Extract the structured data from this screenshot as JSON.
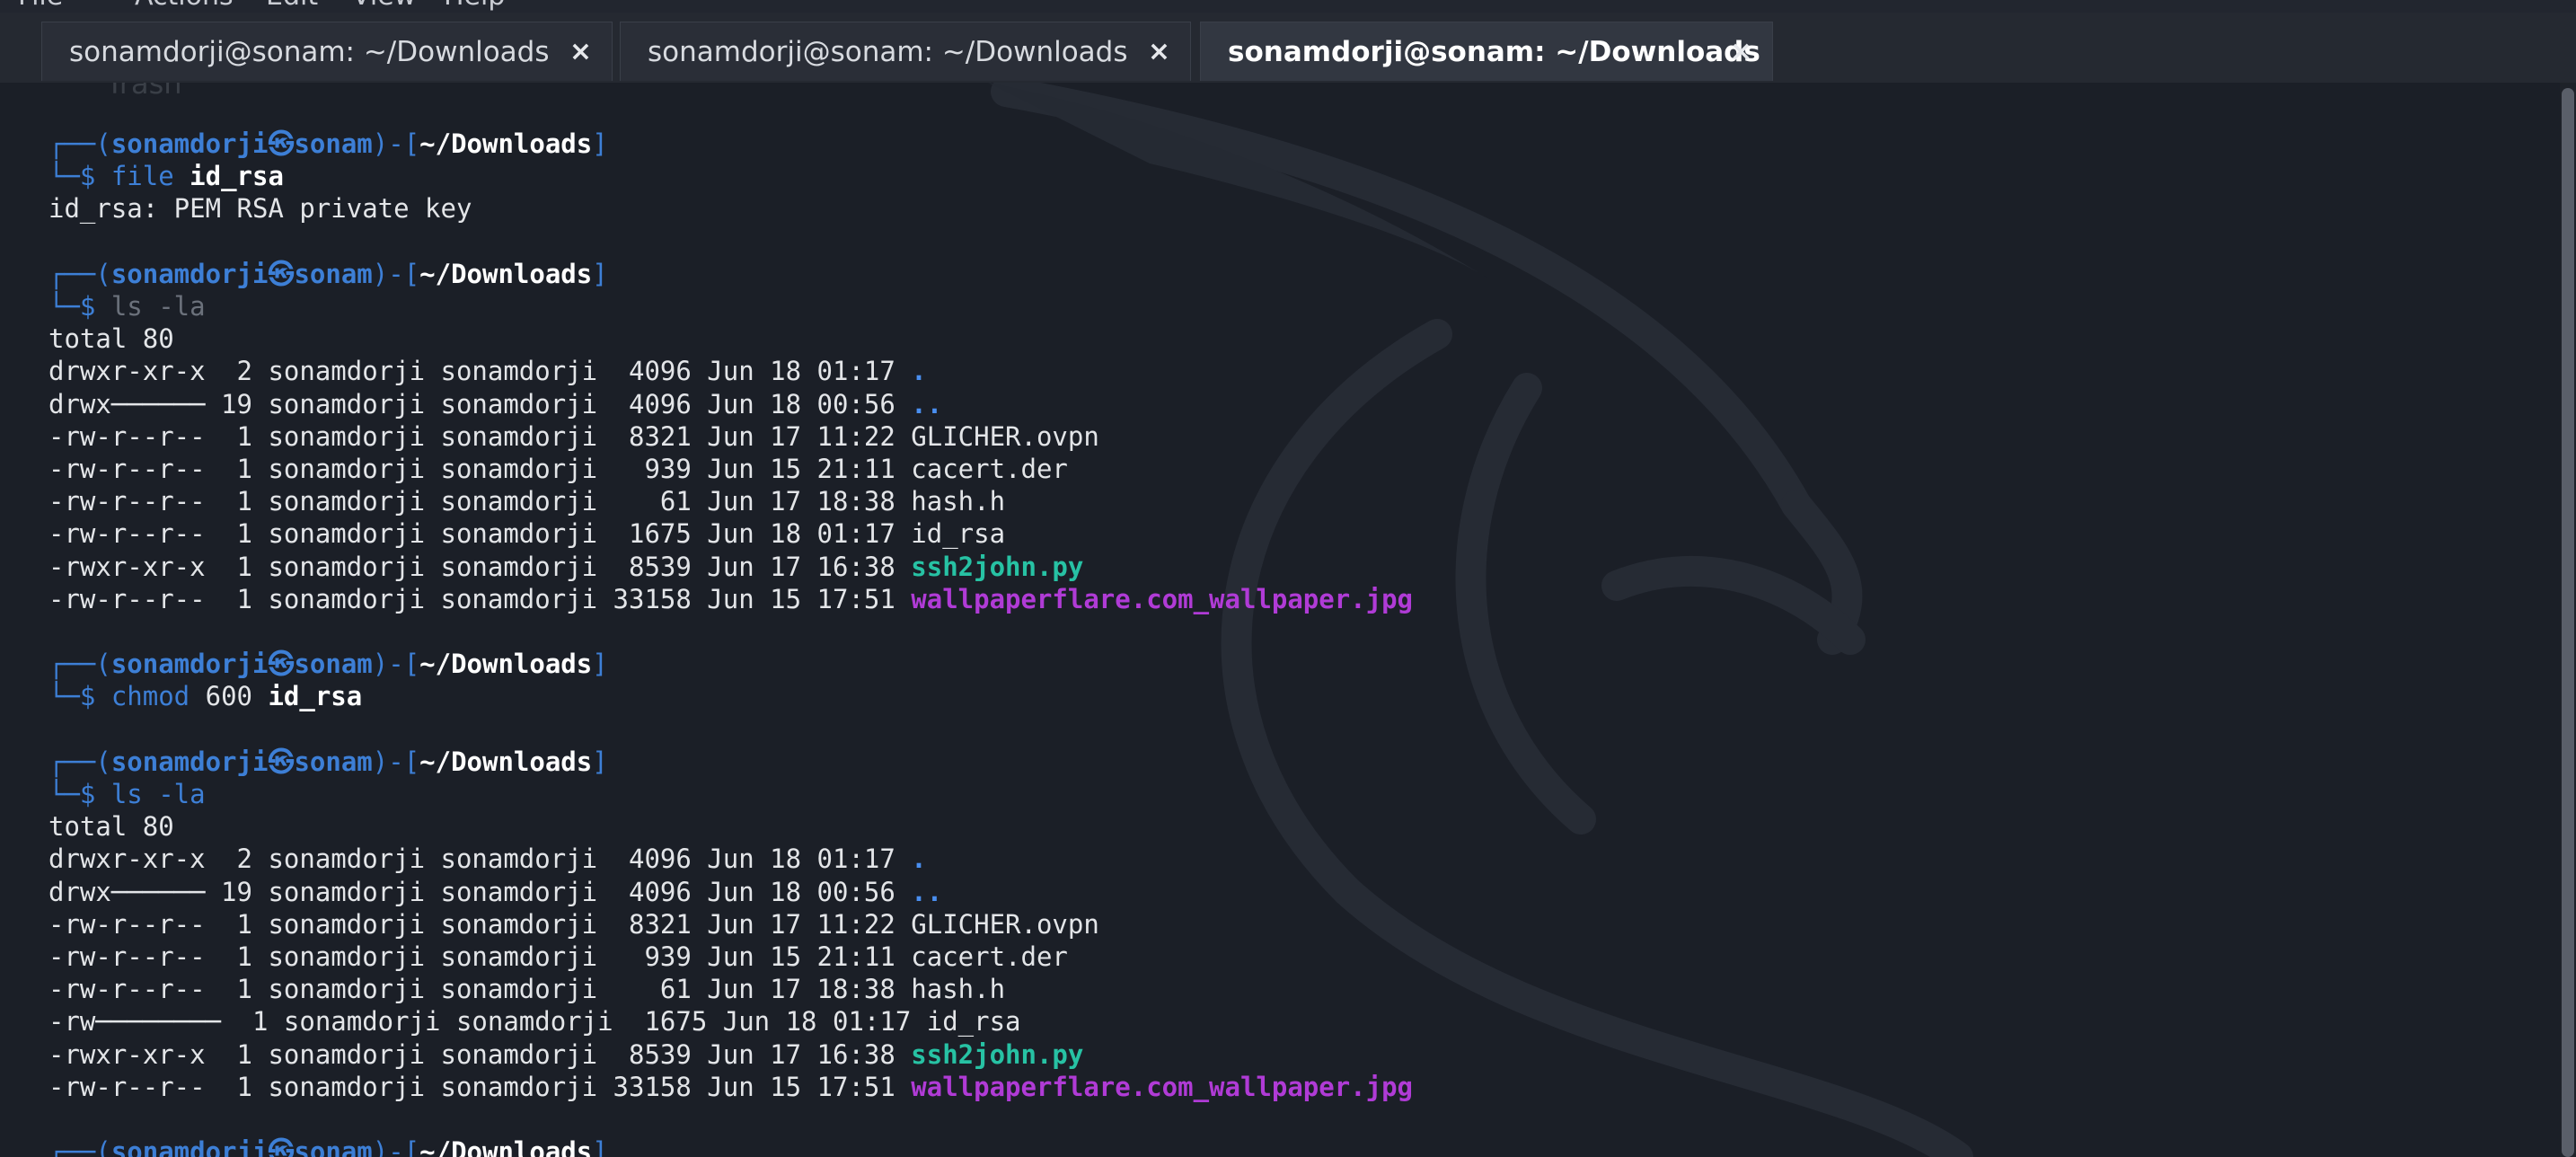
{
  "menubar": {
    "items": [
      "File",
      "Actions",
      "Edit",
      "View",
      "Help"
    ]
  },
  "tabs": [
    {
      "title": "sonamdorji@sonam: ~/Downloads",
      "close": "×",
      "active": false
    },
    {
      "title": "sonamdorji@sonam: ~/Downloads",
      "close": "×",
      "active": false
    },
    {
      "title": "sonamdorji@sonam: ~/Downloads",
      "close": "×",
      "active": true
    }
  ],
  "desktop": {
    "trash_label": "Trash"
  },
  "colors": {
    "prompt": "#3d7fd6",
    "directory": "#4a8ff0",
    "executable": "#27c2a4",
    "image_file": "#b03bd6",
    "background": "#1b1f27"
  },
  "prompt": {
    "open": "┌──(",
    "user": "sonamdorji",
    "at": "㉿",
    "host": "sonam",
    "mid": ")-[",
    "path": "~/Downloads",
    "close": "]",
    "cmd_marker": "└─$ "
  },
  "commands": {
    "file": {
      "cmd": "file",
      "arg": "id_rsa",
      "output": "id_rsa: PEM RSA private key"
    },
    "ls1": {
      "cmd": "ls -la"
    },
    "chmod": {
      "cmd": "chmod",
      "mode": "600",
      "arg": "id_rsa"
    },
    "ls2": {
      "cmd": "ls -la"
    }
  },
  "listing1": {
    "total": "total 80",
    "rows": [
      {
        "perm": "drwxr-xr-x  2",
        "owner": " sonamdorji sonamdorji",
        "meta": "  4096 Jun 18 01:17 ",
        "name": ".",
        "kind": "dir"
      },
      {
        "perm": "drwx────── 19",
        "owner": " sonamdorji sonamdorji",
        "meta": "  4096 Jun 18 00:56 ",
        "name": "..",
        "kind": "dir"
      },
      {
        "perm": "-rw-r--r--  1",
        "owner": " sonamdorji sonamdorji",
        "meta": "  8321 Jun 17 11:22 ",
        "name": "GLICHER.ovpn",
        "kind": "file"
      },
      {
        "perm": "-rw-r--r--  1",
        "owner": " sonamdorji sonamdorji",
        "meta": "   939 Jun 15 21:11 ",
        "name": "cacert.der",
        "kind": "file"
      },
      {
        "perm": "-rw-r--r--  1",
        "owner": " sonamdorji sonamdorji",
        "meta": "    61 Jun 17 18:38 ",
        "name": "hash.h",
        "kind": "file"
      },
      {
        "perm": "-rw-r--r--  1",
        "owner": " sonamdorji sonamdorji",
        "meta": "  1675 Jun 18 01:17 ",
        "name": "id_rsa",
        "kind": "file"
      },
      {
        "perm": "-rwxr-xr-x  1",
        "owner": " sonamdorji sonamdorji",
        "meta": "  8539 Jun 17 16:38 ",
        "name": "ssh2john.py",
        "kind": "exec"
      },
      {
        "perm": "-rw-r--r--  1",
        "owner": " sonamdorji sonamdorji",
        "meta": " 33158 Jun 15 17:51 ",
        "name": "wallpaperflare.com_wallpaper.jpg",
        "kind": "img"
      }
    ]
  },
  "listing2": {
    "total": "total 80",
    "rows": [
      {
        "perm": "drwxr-xr-x  2",
        "owner": " sonamdorji sonamdorji",
        "meta": "  4096 Jun 18 01:17 ",
        "name": ".",
        "kind": "dir"
      },
      {
        "perm": "drwx────── 19",
        "owner": " sonamdorji sonamdorji",
        "meta": "  4096 Jun 18 00:56 ",
        "name": "..",
        "kind": "dir"
      },
      {
        "perm": "-rw-r--r--  1",
        "owner": " sonamdorji sonamdorji",
        "meta": "  8321 Jun 17 11:22 ",
        "name": "GLICHER.ovpn",
        "kind": "file"
      },
      {
        "perm": "-rw-r--r--  1",
        "owner": " sonamdorji sonamdorji",
        "meta": "   939 Jun 15 21:11 ",
        "name": "cacert.der",
        "kind": "file"
      },
      {
        "perm": "-rw-r--r--  1",
        "owner": " sonamdorji sonamdorji",
        "meta": "    61 Jun 17 18:38 ",
        "name": "hash.h",
        "kind": "file"
      },
      {
        "perm": "-rw────────  1",
        "owner": " sonamdorji sonamdorji",
        "meta": "  1675 Jun 18 01:17 ",
        "name": "id_rsa",
        "kind": "file"
      },
      {
        "perm": "-rwxr-xr-x  1",
        "owner": " sonamdorji sonamdorji",
        "meta": "  8539 Jun 17 16:38 ",
        "name": "ssh2john.py",
        "kind": "exec"
      },
      {
        "perm": "-rw-r--r--  1",
        "owner": " sonamdorji sonamdorji",
        "meta": " 33158 Jun 15 17:51 ",
        "name": "wallpaperflare.com_wallpaper.jpg",
        "kind": "img"
      }
    ]
  }
}
